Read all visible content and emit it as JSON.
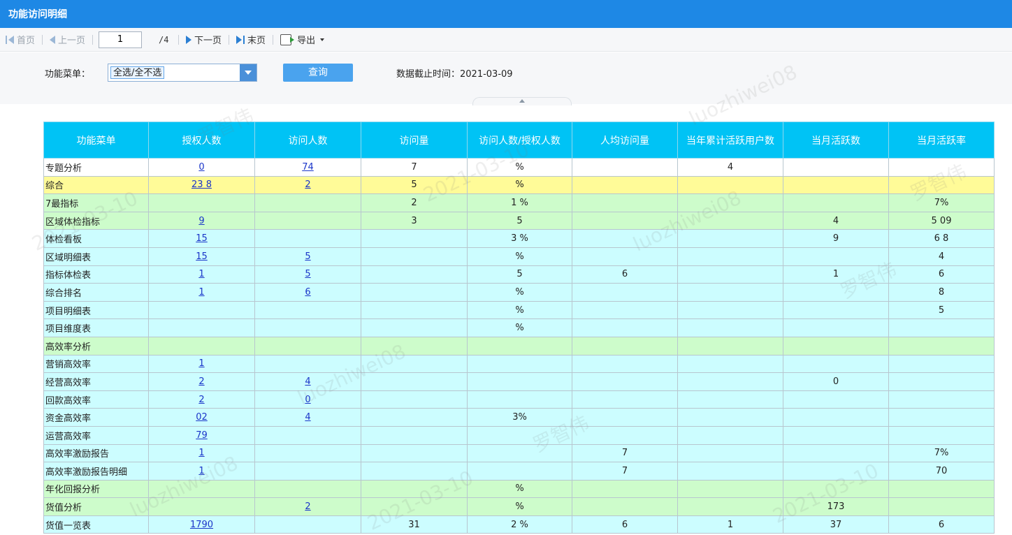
{
  "window": {
    "title": "功能访问明细"
  },
  "toolbar": {
    "first": "首页",
    "prev": "上一页",
    "page_value": "1",
    "page_total": "/4",
    "next": "下一页",
    "last": "末页",
    "export": "导出"
  },
  "filter": {
    "menu_label": "功能菜单：",
    "menu_selected": "全选/全不选",
    "query_button": "查询",
    "cutoff_label": "数据截止时间：2021-03-09"
  },
  "table": {
    "headers": [
      "功能菜单",
      "授权人数",
      "访问人数",
      "访问量",
      "访问人数/授权人数",
      "人均访问量",
      "当年累计活跃用户数",
      "当月活跃数",
      "当月活跃率"
    ],
    "rows": [
      {
        "menu": "专题分析",
        "auth": "0",
        "visitors": "74",
        "visits": "7",
        "ratio": "%",
        "avg": "",
        "year": "4",
        "month": "",
        "rate": "",
        "color": "white"
      },
      {
        "menu": "综合",
        "auth": "23 8",
        "visitors": "2",
        "visits": "5",
        "ratio": "%",
        "avg": "",
        "year": "",
        "month": "",
        "rate": "",
        "color": "yellow"
      },
      {
        "menu": "7最指标",
        "auth": "",
        "visitors": "",
        "visits": "2",
        "ratio": "1 %",
        "avg": "",
        "year": "",
        "month": "",
        "rate": "7%",
        "color": "green"
      },
      {
        "menu": "区域体检指标",
        "auth": "9",
        "visitors": "",
        "visits": "3",
        "ratio": "5",
        "avg": "",
        "year": "",
        "month": "4",
        "rate": "5 09",
        "color": "green"
      },
      {
        "menu": "体检看板",
        "auth": "15",
        "visitors": "",
        "visits": "",
        "ratio": "3 %",
        "avg": "",
        "year": "",
        "month": "9",
        "rate": "6 8",
        "color": "cyan"
      },
      {
        "menu": "区域明细表",
        "auth": "15",
        "visitors": "5",
        "visits": "",
        "ratio": "%",
        "avg": "",
        "year": "",
        "month": "",
        "rate": "4",
        "color": "cyan"
      },
      {
        "menu": "指标体检表",
        "auth": "1",
        "visitors": "5",
        "visits": "",
        "ratio": "5",
        "avg": "6",
        "year": "",
        "month": "1",
        "rate": "6",
        "color": "cyan"
      },
      {
        "menu": "综合排名",
        "auth": "1",
        "visitors": "6",
        "visits": "",
        "ratio": "%",
        "avg": "",
        "year": "",
        "month": "",
        "rate": "8",
        "color": "cyan"
      },
      {
        "menu": "项目明细表",
        "auth": "",
        "visitors": "",
        "visits": "",
        "ratio": "%",
        "avg": "",
        "year": "",
        "month": "",
        "rate": "5",
        "color": "cyan"
      },
      {
        "menu": "项目维度表",
        "auth": "",
        "visitors": "",
        "visits": "",
        "ratio": "%",
        "avg": "",
        "year": "",
        "month": "",
        "rate": "",
        "color": "cyan"
      },
      {
        "menu": "高效率分析",
        "auth": "",
        "visitors": "",
        "visits": "",
        "ratio": "",
        "avg": "",
        "year": "",
        "month": "",
        "rate": "",
        "color": "green"
      },
      {
        "menu": "营销高效率",
        "auth": "1",
        "visitors": "",
        "visits": "",
        "ratio": "",
        "avg": "",
        "year": "",
        "month": "",
        "rate": "",
        "color": "cyan"
      },
      {
        "menu": "经营高效率",
        "auth": "2",
        "visitors": "4",
        "visits": "",
        "ratio": "",
        "avg": "",
        "year": "",
        "month": "0",
        "rate": "",
        "color": "cyan"
      },
      {
        "menu": "回款高效率",
        "auth": "2",
        "visitors": "0",
        "visits": "",
        "ratio": "",
        "avg": "",
        "year": "",
        "month": "",
        "rate": "",
        "color": "cyan"
      },
      {
        "menu": "资金高效率",
        "auth": "02",
        "visitors": "4",
        "visits": "",
        "ratio": "3%",
        "avg": "",
        "year": "",
        "month": "",
        "rate": "",
        "color": "cyan"
      },
      {
        "menu": "运营高效率",
        "auth": "79",
        "visitors": "",
        "visits": "",
        "ratio": "",
        "avg": "",
        "year": "",
        "month": "",
        "rate": "",
        "color": "cyan"
      },
      {
        "menu": "高效率激励报告",
        "auth": "1",
        "visitors": "",
        "visits": "",
        "ratio": "",
        "avg": "7",
        "year": "",
        "month": "",
        "rate": "7%",
        "color": "cyan"
      },
      {
        "menu": "高效率激励报告明细",
        "auth": "1",
        "visitors": "",
        "visits": "",
        "ratio": "",
        "avg": "7",
        "year": "",
        "month": "",
        "rate": "70",
        "color": "cyan"
      },
      {
        "menu": "年化回报分析",
        "auth": "",
        "visitors": "",
        "visits": "",
        "ratio": "%",
        "avg": "",
        "year": "",
        "month": "",
        "rate": "",
        "color": "green"
      },
      {
        "menu": "货值分析",
        "auth": "",
        "visitors": "2",
        "visits": "",
        "ratio": "%",
        "avg": "",
        "year": "",
        "month": "173",
        "rate": "",
        "color": "green"
      },
      {
        "menu": "货值一览表",
        "auth": "1790",
        "visitors": "",
        "visits": "31",
        "ratio": "2 %",
        "avg": "6",
        "year": "1",
        "month": "37",
        "rate": "6",
        "color": "cyan"
      }
    ]
  },
  "watermark": [
    "罗智伟",
    "2021-03-10",
    "luozhiwei08"
  ]
}
